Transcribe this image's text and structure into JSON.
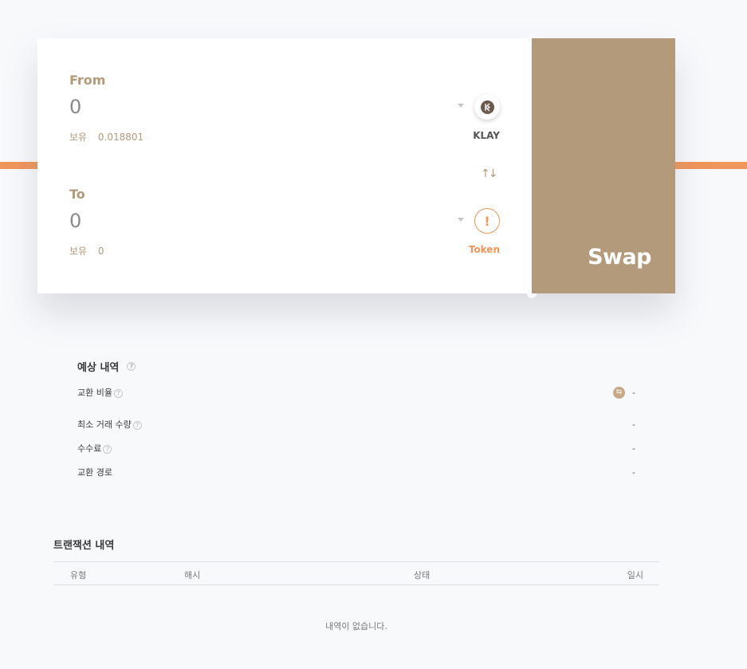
{
  "swap": {
    "from": {
      "label": "From",
      "amount": "0",
      "balance_label": "보유",
      "balance_value": "0.018801",
      "token_symbol": "KLAY",
      "token_icon": "klay-logo-icon"
    },
    "to": {
      "label": "To",
      "amount": "0",
      "balance_label": "보유",
      "balance_value": "0",
      "token_symbol": "Token",
      "token_icon": "warning-icon"
    },
    "switch_icon": "↑↓",
    "button_label": "Swap"
  },
  "estimate": {
    "title": "예상 내역",
    "rows": [
      {
        "label": "교환 비율",
        "value": "-",
        "has_help": true
      },
      {
        "label": "최소 거래 수량",
        "value": "-",
        "has_help": true
      },
      {
        "label": "수수료",
        "value": "-",
        "has_help": true
      },
      {
        "label": "교환 경로",
        "value": "-",
        "has_help": false
      }
    ]
  },
  "transactions": {
    "title": "트랜잭션 내역",
    "columns": [
      "유형",
      "해시",
      "상태",
      "일시"
    ],
    "empty_message": "내역이 없습니다."
  },
  "colors": {
    "accent_orange": "#f0965a",
    "brand_tan": "#b39a7a",
    "background": "#f8f9fb"
  }
}
